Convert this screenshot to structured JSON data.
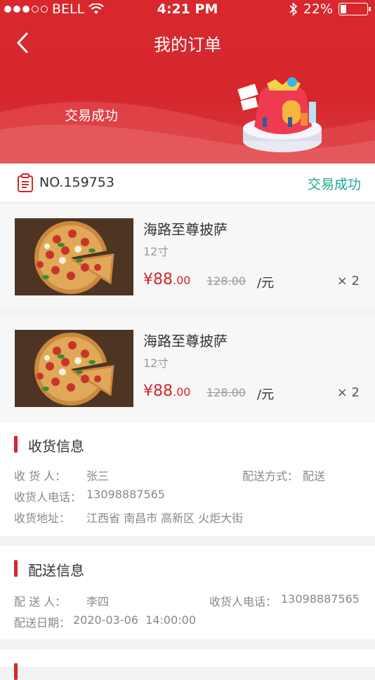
{
  "status_bar": {
    "carrier": "BELL",
    "time": "4:21 PM",
    "battery": "22%"
  },
  "nav": {
    "title": "我的订单"
  },
  "header": {
    "status_text": "交易成功"
  },
  "order": {
    "number": "NO.159753",
    "state": "交易成功"
  },
  "items": [
    {
      "name": "海路至尊披萨",
      "spec": "12寸",
      "currency": "¥",
      "price_int": "88",
      "price_dec": ".00",
      "original_price": "128.00",
      "unit": "/元",
      "qty": "× 2"
    },
    {
      "name": "海路至尊披萨",
      "spec": "12寸",
      "currency": "¥",
      "price_int": "88",
      "price_dec": ".00",
      "original_price": "128.00",
      "unit": "/元",
      "qty": "× 2"
    }
  ],
  "receiving": {
    "title": "收货信息",
    "receiver_label": "收 货 人：",
    "receiver": "张三",
    "method_label": "配送方式：",
    "method": "配送",
    "phone_label": "收货人电话：",
    "phone": "13098887565",
    "address_label": "收货地址：",
    "address": "江西省 南昌市 高新区 火炬大街"
  },
  "delivery": {
    "title": "配送信息",
    "courier_label": "配 送 人：",
    "courier": "李四",
    "phone_label": "收货人电话：",
    "phone": "13098887565",
    "date_label": "配送日期：",
    "date": "2020-03-06  14:00:00"
  },
  "colors": {
    "brand_red": "#d5272d",
    "success_green": "#1fa895"
  }
}
